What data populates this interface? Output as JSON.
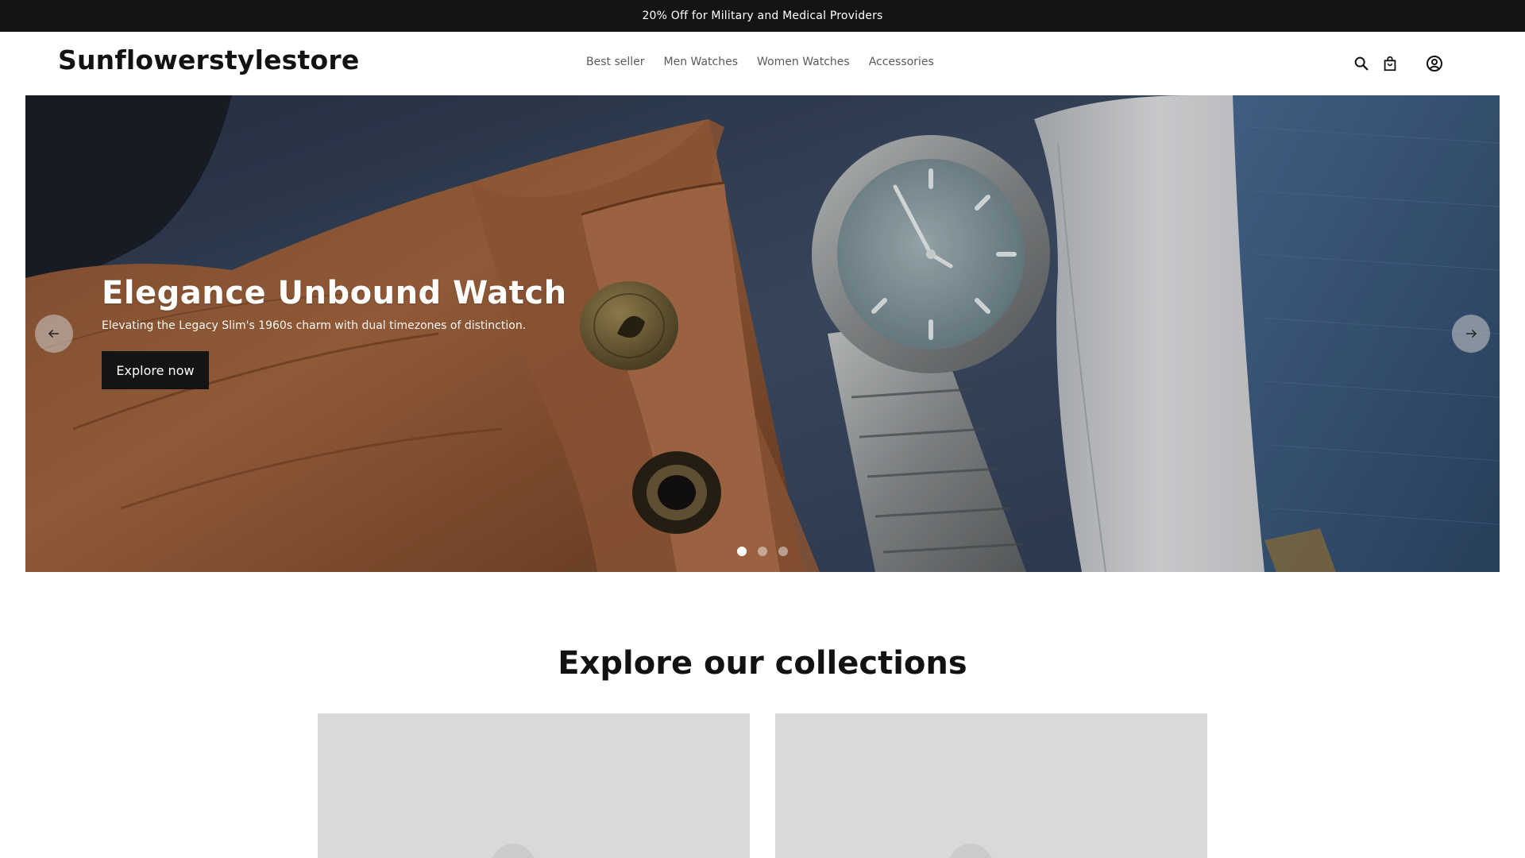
{
  "announcement": {
    "text": "20% Off for Military and Medical Providers"
  },
  "header": {
    "logo": "Sunflowerstylestore",
    "nav": [
      {
        "label": "Best seller"
      },
      {
        "label": "Men Watches"
      },
      {
        "label": "Women Watches"
      },
      {
        "label": "Accessories"
      }
    ],
    "icons": [
      "search-icon",
      "cart-icon",
      "account-icon"
    ]
  },
  "hero": {
    "title": "Elegance Unbound Watch",
    "subtitle": "Elevating the Legacy Slim's 1960s charm with dual timezones of distinction.",
    "button_label": "Explore now",
    "slides_total": 3,
    "active_slide": 1
  },
  "collections": {
    "title": "Explore our collections",
    "cards": 2
  },
  "colors": {
    "announcement_bg": "#141414",
    "text": "#121212",
    "nav_text": "#5a5a5a",
    "button_bg": "#141414",
    "card_placeholder": "#d9d9d9"
  }
}
